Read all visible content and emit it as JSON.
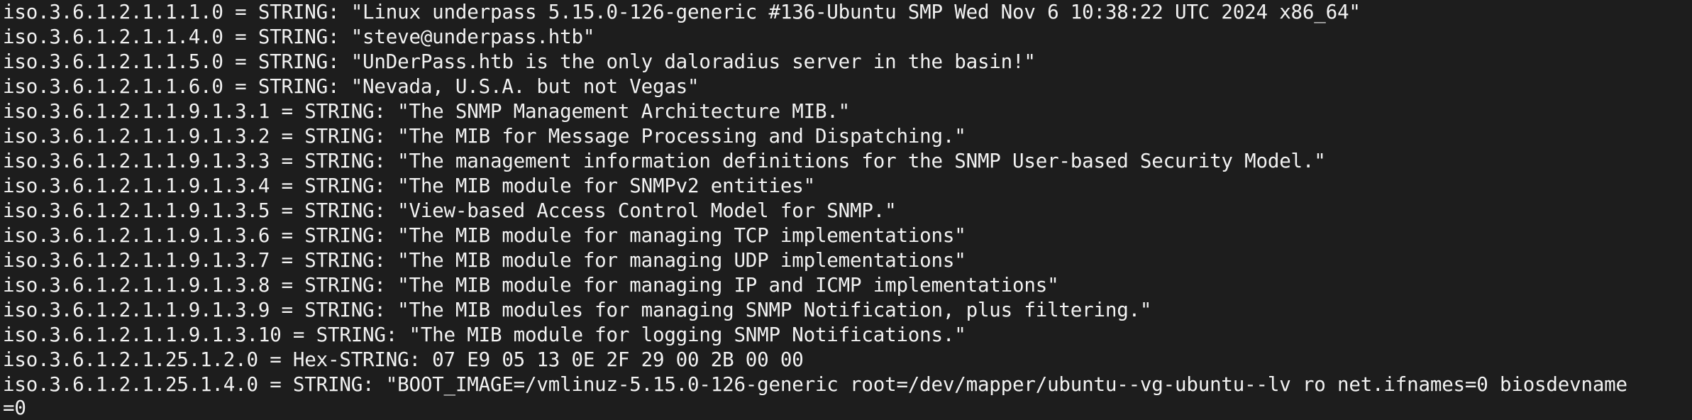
{
  "colors": {
    "background": "#1d1d1d",
    "foreground": "#f2f2f2"
  },
  "terminal": {
    "lines": [
      "iso.3.6.1.2.1.1.1.0 = STRING: \"Linux underpass 5.15.0-126-generic #136-Ubuntu SMP Wed Nov 6 10:38:22 UTC 2024 x86_64\"",
      "iso.3.6.1.2.1.1.4.0 = STRING: \"steve@underpass.htb\"",
      "iso.3.6.1.2.1.1.5.0 = STRING: \"UnDerPass.htb is the only daloradius server in the basin!\"",
      "iso.3.6.1.2.1.1.6.0 = STRING: \"Nevada, U.S.A. but not Vegas\"",
      "iso.3.6.1.2.1.1.9.1.3.1 = STRING: \"The SNMP Management Architecture MIB.\"",
      "iso.3.6.1.2.1.1.9.1.3.2 = STRING: \"The MIB for Message Processing and Dispatching.\"",
      "iso.3.6.1.2.1.1.9.1.3.3 = STRING: \"The management information definitions for the SNMP User-based Security Model.\"",
      "iso.3.6.1.2.1.1.9.1.3.4 = STRING: \"The MIB module for SNMPv2 entities\"",
      "iso.3.6.1.2.1.1.9.1.3.5 = STRING: \"View-based Access Control Model for SNMP.\"",
      "iso.3.6.1.2.1.1.9.1.3.6 = STRING: \"The MIB module for managing TCP implementations\"",
      "iso.3.6.1.2.1.1.9.1.3.7 = STRING: \"The MIB module for managing UDP implementations\"",
      "iso.3.6.1.2.1.1.9.1.3.8 = STRING: \"The MIB module for managing IP and ICMP implementations\"",
      "iso.3.6.1.2.1.1.9.1.3.9 = STRING: \"The MIB modules for managing SNMP Notification, plus filtering.\"",
      "iso.3.6.1.2.1.1.9.1.3.10 = STRING: \"The MIB module for logging SNMP Notifications.\"",
      "iso.3.6.1.2.1.25.1.2.0 = Hex-STRING: 07 E9 05 13 0E 2F 29 00 2B 00 00",
      "iso.3.6.1.2.1.25.1.4.0 = STRING: \"BOOT_IMAGE=/vmlinuz-5.15.0-126-generic root=/dev/mapper/ubuntu--vg-ubuntu--lv ro net.ifnames=0 biosdevname",
      "=0"
    ]
  }
}
